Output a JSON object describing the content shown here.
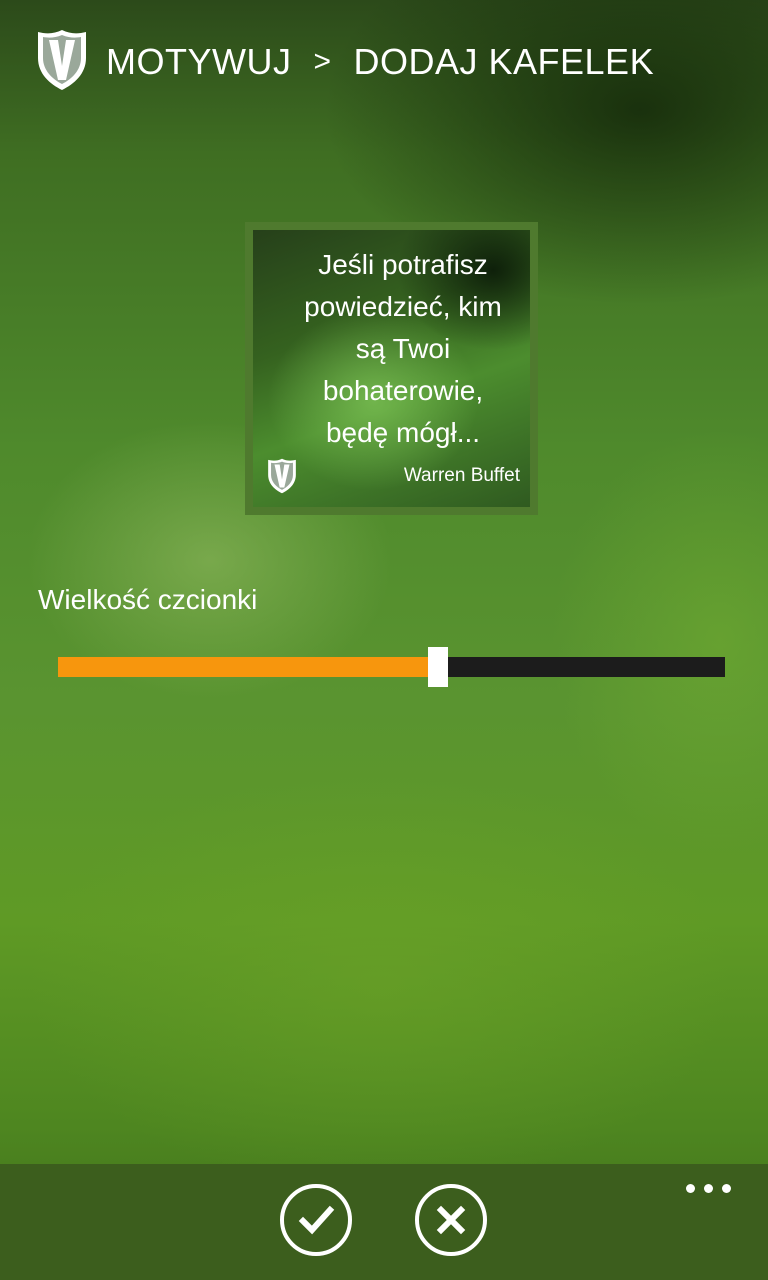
{
  "header": {
    "app_name": "MOTYWUJ",
    "separator": ">",
    "page_title": "DODAJ KAFELEK",
    "logo_icon": "shield-logo-icon"
  },
  "tile": {
    "quote": "Jeśli potrafisz\npowiedzieć, kim\nsą Twoi\nbohaterowie,\nbędę mógł...",
    "author": "Warren Buffet",
    "logo_icon": "shield-logo-icon"
  },
  "font_size": {
    "label": "Wielkość czcionki",
    "value_fraction": 0.57
  },
  "appbar": {
    "accept_icon": "check-icon",
    "cancel_icon": "close-icon",
    "more_icon": "ellipsis-icon"
  },
  "colors": {
    "accent": "#f7960d",
    "track": "#1c1c1c",
    "appbar": "#3c5e1d"
  }
}
